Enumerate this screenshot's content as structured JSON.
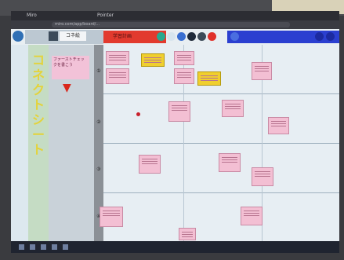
{
  "window": {
    "tab_label": "Miro",
    "tab2_label": "Pointer",
    "address": "miro.com/app/board/..."
  },
  "toolbar": {
    "back_label": "コネ絵",
    "section_label": "学習計画",
    "colors": {
      "red": "#e23a2e",
      "blue": "#2b3fd0"
    }
  },
  "board": {
    "vertical_title": "コネクトシート",
    "intro_note": "ファーストチェックを書こう",
    "row_labels": [
      "①",
      "②",
      "③",
      "④"
    ]
  }
}
